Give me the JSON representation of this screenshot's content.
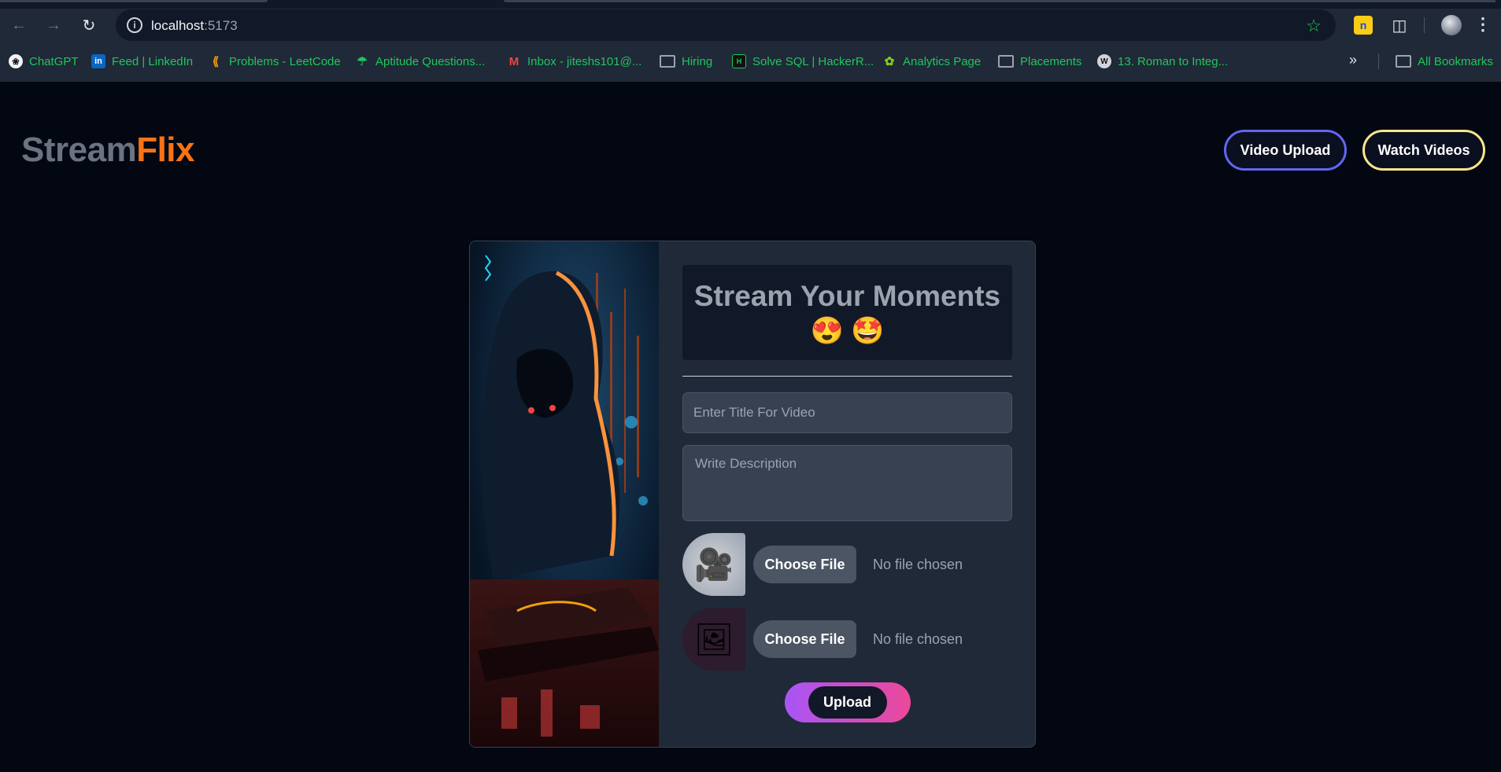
{
  "browser": {
    "url_host": "localhost",
    "url_port": ":5173",
    "bookmarks": [
      {
        "label": "ChatGPT",
        "icon": "chatgpt-icon"
      },
      {
        "label": "Feed | LinkedIn",
        "icon": "linkedin-icon"
      },
      {
        "label": "Problems - LeetCode",
        "icon": "leetcode-icon"
      },
      {
        "label": "Aptitude Questions...",
        "icon": "aptitude-icon"
      },
      {
        "label": "Inbox - jiteshs101@...",
        "icon": "gmail-icon"
      },
      {
        "label": "Hiring",
        "icon": "folder-icon"
      },
      {
        "label": "Solve SQL | HackerR...",
        "icon": "hackerrank-icon"
      },
      {
        "label": "Analytics Page",
        "icon": "leaf-icon"
      },
      {
        "label": "Placements",
        "icon": "folder-icon"
      },
      {
        "label": "13. Roman to Integ...",
        "icon": "w-icon"
      }
    ],
    "all_bookmarks": "All Bookmarks",
    "ext_label": "n"
  },
  "app": {
    "logo_part1": "Stream",
    "logo_part2": "Flix",
    "nav": {
      "video_upload": "Video Upload",
      "watch_videos": "Watch Videos"
    },
    "form": {
      "heading": "Stream Your Moments",
      "emojis": "😍 🤩",
      "title_placeholder": "Enter Title For Video",
      "description_placeholder": "Write Description",
      "choose_file_label": "Choose File",
      "no_file_text": "No file chosen",
      "upload_label": "Upload"
    }
  },
  "colors": {
    "page_bg": "#030712",
    "logo_gray": "#6b7280",
    "logo_orange": "#f97316",
    "card_bg": "#1f2937",
    "upload_gradient_start": "#a855f7",
    "upload_gradient_end": "#ec4899"
  }
}
